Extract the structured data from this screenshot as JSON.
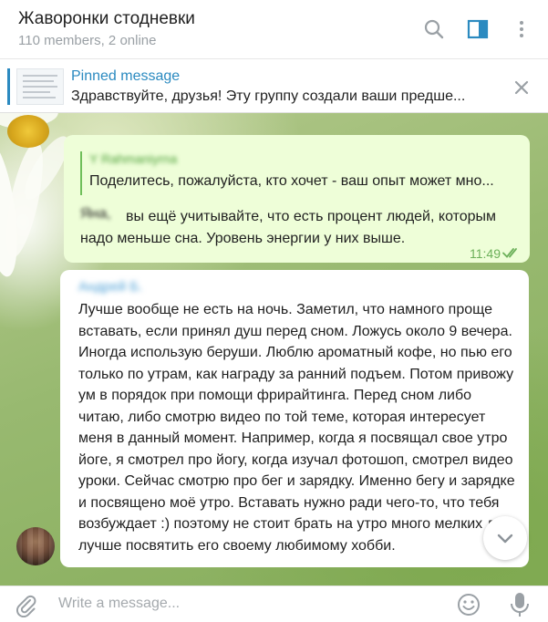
{
  "header": {
    "title": "Жаворонки стодневки",
    "subtitle": "110 members, 2 online",
    "icons": [
      "search-icon",
      "sidebar-toggle-icon",
      "more-vertical-icon"
    ]
  },
  "pinned": {
    "label": "Pinned message",
    "text": "Здравствуйте, друзья!  Эту группу создали ваши предше..."
  },
  "messages": {
    "outgoing": {
      "reply_name": "Y Rahmaniyrna",
      "reply_text": "Поделитесь, пожалуйста, кто хочет - ваш опыт может мно...",
      "prefix": "Яна,",
      "text": "вы ещё учитывайте, что есть процент людей, которым надо меньше сна. Уровень энергии у них выше.",
      "time": "11:49",
      "status": "read"
    },
    "incoming": {
      "sender": "Андрей Б.",
      "text": "Лучше вообще не есть на ночь. Заметил, что намного проще вставать, если принял душ перед сном. Ложусь около 9 вечера. Иногда использую беруши. Люблю ароматный кофе, но пью его только по утрам, как награду за ранний подъем. Потом привожу ум в порядок при помощи фрирайтинга. Перед сном либо читаю, либо смотрю видео по той теме, которая интересует меня в данный момент. Например, когда я посвящал свое утро йоге, я смотрел про йогу, когда изучал фотошоп, смотрел видео уроки. Сейчас смотрю про бег и зарядку. Именно бегу и зарядке и посвящено моё утро. Вставать нужно ради чего-то, что тебя возбуждает :) поэтому не стоит брать на утро много мелких дел, лучше посвятить его своему любимому хобби."
    }
  },
  "composer": {
    "placeholder": "Write a message..."
  },
  "colors": {
    "accent": "#2b8ac0",
    "outgoing_bubble": "#eefed8",
    "read_check": "#6cb05a"
  }
}
